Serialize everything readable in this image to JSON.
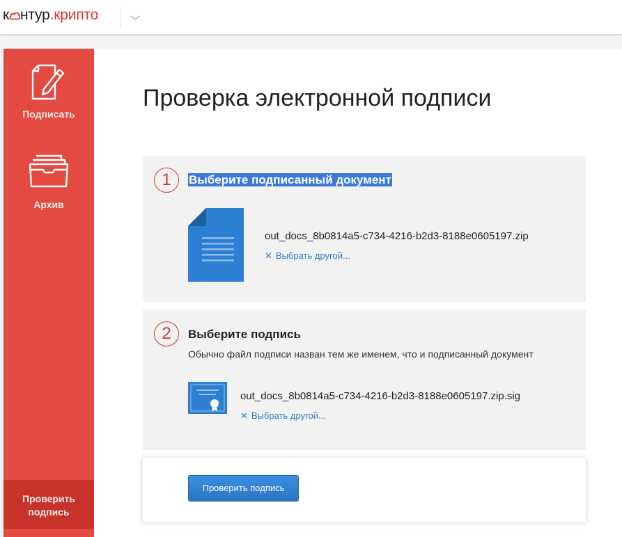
{
  "header": {
    "logo_part1": "к",
    "logo_part2": "нтур",
    "logo_part3": ".крипто",
    "logo_icon": "cloud-icon",
    "menu_icon": "chevron-down-icon"
  },
  "sidebar": {
    "sign_label": "Подписать",
    "archive_label": "Архив",
    "check_label_line1": "Проверить",
    "check_label_line2": "подпись"
  },
  "main": {
    "title": "Проверка электронной подписи",
    "step1": {
      "number": "1",
      "title": "Выберите подписанный документ",
      "file_name": "out_docs_8b0814a5-c734-4216-b2d3-8188e0605197.zip",
      "change_link": "Выбрать другой..."
    },
    "step2": {
      "number": "2",
      "title": "Выберите подпись",
      "description": "Обычно файл подписи назван тем же именем, что и подписанный документ",
      "file_name": "out_docs_8b0814a5-c734-4216-b2d3-8188e0605197.zip.sig",
      "change_link": "Выбрать другой..."
    },
    "submit_button": "Проверить подпись"
  },
  "colors": {
    "accent_red": "#e24a42",
    "link_blue": "#2f7bc8",
    "button_blue": "#2a74c4",
    "doc_icon_blue": "#2d7fd3"
  }
}
